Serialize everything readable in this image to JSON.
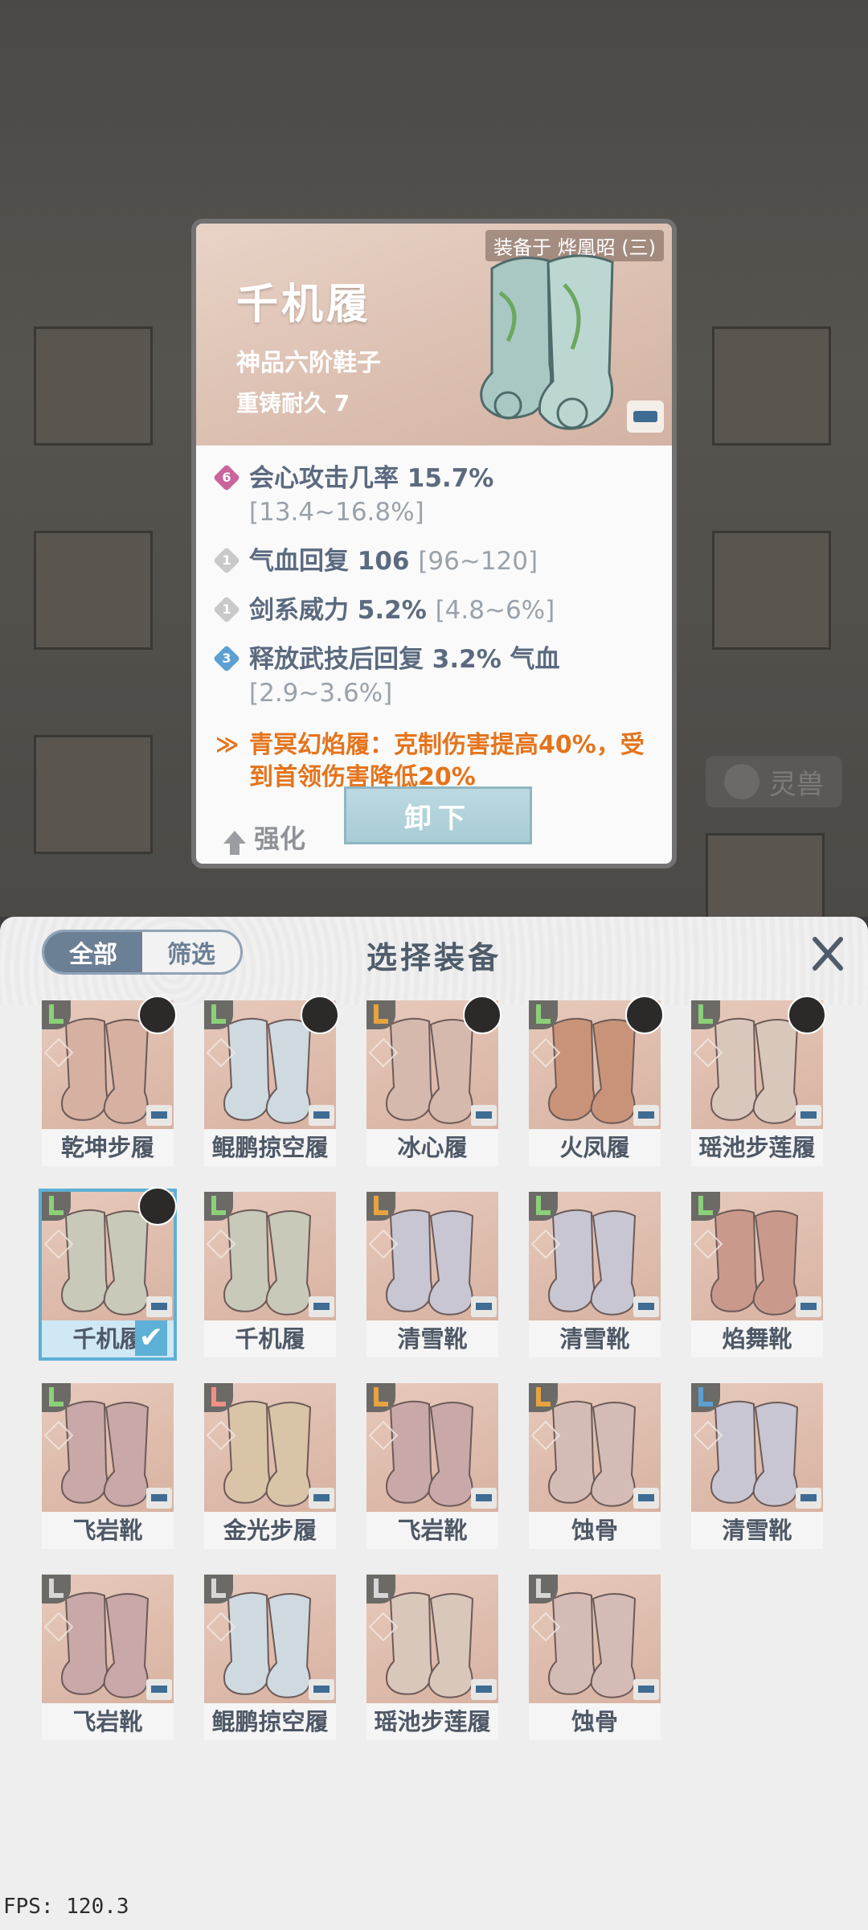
{
  "tooltip": {
    "equipped_label": "装备于 烨凰昭 (三)",
    "title": "千机履",
    "subtitle": "神品六阶鞋子",
    "durability": "重铸耐久 7",
    "stats": [
      {
        "tier": "6",
        "tier_color": "#c9659a",
        "text": "会心攻击几率 15.7%",
        "range": "[13.4~16.8%]"
      },
      {
        "tier": "1",
        "tier_color": "#c9c9c9",
        "text": "气血回复 106",
        "range": "[96~120]"
      },
      {
        "tier": "1",
        "tier_color": "#c9c9c9",
        "text": "剑系威力 5.2%",
        "range": "[4.8~6%]"
      },
      {
        "tier": "3",
        "tier_color": "#5c9fd3",
        "text": "释放武技后回复 3.2% 气血",
        "range": "[2.9~3.6%]"
      }
    ],
    "set_bonus": "青冥幻焰履：克制伤害提高40%，受到首领伤害降低20%",
    "upgrade_label": "强化",
    "unequip_label": "卸下"
  },
  "background": {
    "tab_label": "灵兽"
  },
  "panel": {
    "filter_all": "全部",
    "filter_select": "筛选",
    "title": "选择装备"
  },
  "items": [
    {
      "name": "乾坤步履",
      "color": "#d6b0a0",
      "slot_color": "#8bd078",
      "avatar": true
    },
    {
      "name": "鲲鹏掠空履",
      "color": "#cfd9e0",
      "slot_color": "#8bd078",
      "avatar": true
    },
    {
      "name": "冰心履",
      "color": "#d6b9ad",
      "slot_color": "#e6a340",
      "avatar": true
    },
    {
      "name": "火凤履",
      "color": "#c99379",
      "slot_color": "#8bd078",
      "avatar": true
    },
    {
      "name": "瑶池步莲履",
      "color": "#d9c7bb",
      "slot_color": "#8bd078",
      "avatar": true
    },
    {
      "name": "千机履",
      "color": "#c8c9b8",
      "slot_color": "#8bd078",
      "avatar": true,
      "selected": true
    },
    {
      "name": "千机履",
      "color": "#c8c9b8",
      "slot_color": "#8bd078"
    },
    {
      "name": "清雪靴",
      "color": "#c7c6d2",
      "slot_color": "#e6a340"
    },
    {
      "name": "清雪靴",
      "color": "#c7c6d2",
      "slot_color": "#8bd078"
    },
    {
      "name": "焰舞靴",
      "color": "#c99a8c",
      "slot_color": "#8bd078"
    },
    {
      "name": "飞岩靴",
      "color": "#c9a8a8",
      "slot_color": "#8bd078"
    },
    {
      "name": "金光步履",
      "color": "#d9c4a8",
      "slot_color": "#ef8f86"
    },
    {
      "name": "飞岩靴",
      "color": "#c9a8a8",
      "slot_color": "#e6a340"
    },
    {
      "name": "蚀骨",
      "color": "#d4bbb5",
      "slot_color": "#e6a340"
    },
    {
      "name": "清雪靴",
      "color": "#c7c6d2",
      "slot_color": "#5c9fd3"
    },
    {
      "name": "飞岩靴",
      "color": "#c9a8a8",
      "slot_color": "#d6d6d6"
    },
    {
      "name": "鲲鹏掠空履",
      "color": "#cfd9e0",
      "slot_color": "#d6d6d6"
    },
    {
      "name": "瑶池步莲履",
      "color": "#d9c7bb",
      "slot_color": "#d6d6d6"
    },
    {
      "name": "蚀骨",
      "color": "#d4bbb5",
      "slot_color": "#d6d6d6"
    }
  ],
  "debug": {
    "fps": "FPS: 120.3"
  }
}
